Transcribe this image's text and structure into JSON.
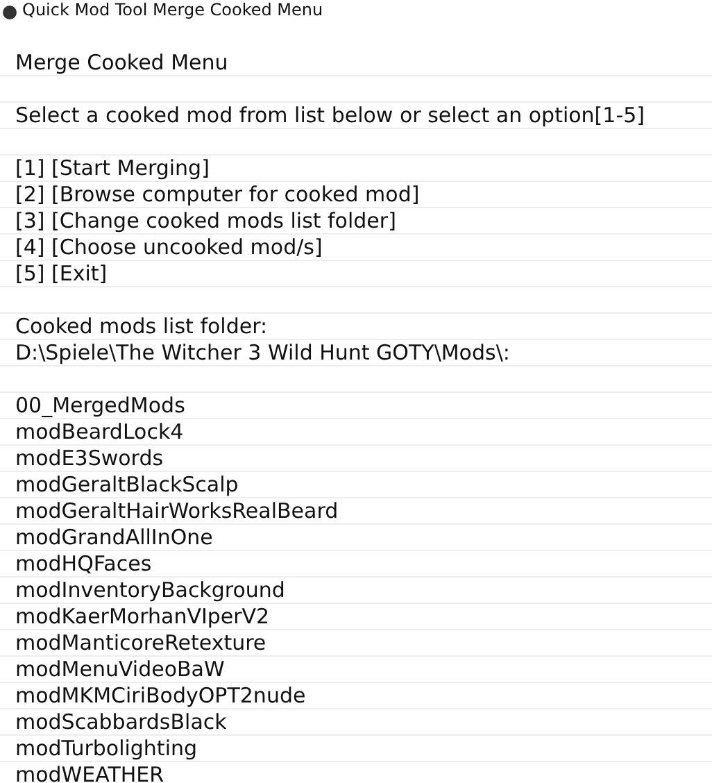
{
  "window": {
    "title": "Quick Mod Tool Merge Cooked Menu"
  },
  "heading": "Merge Cooked Menu",
  "prompt": "Select a cooked mod from list below or select an option[1-5]",
  "options": [
    "[1] [Start Merging]",
    "[2] [Browse computer for cooked mod]",
    "[3] [Change cooked mods list folder]",
    "[4] [Choose uncooked mod/s]",
    "[5] [Exit]"
  ],
  "folder_label": "Cooked mods list folder:",
  "folder_path": "D:\\Spiele\\The Witcher 3 Wild Hunt GOTY\\Mods\\:",
  "mods": [
    "00_MergedMods",
    "modBeardLock4",
    "modE3Swords",
    "modGeraltBlackScalp",
    "modGeraltHairWorksRealBeard",
    "modGrandAllInOne",
    "modHQFaces",
    "modInventoryBackground",
    "modKaerMorhanVIperV2",
    "modManticoreRetexture",
    "modMenuVideoBaW",
    "modMKMCiriBodyOPT2nude",
    "modScabbardsBlack",
    "modTurbolighting",
    "modWEATHER"
  ]
}
